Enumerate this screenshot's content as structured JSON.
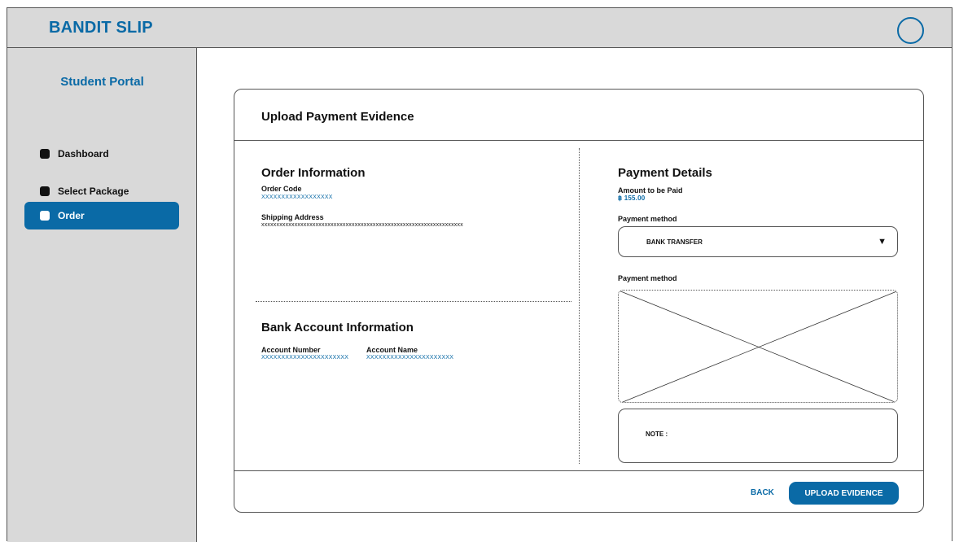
{
  "app": {
    "brand": "BANDIT SLIP"
  },
  "sidebar": {
    "title": "Student Portal",
    "items": [
      {
        "label": "Dashboard",
        "active": false
      },
      {
        "label": "Select Package",
        "active": false
      },
      {
        "label": "Order",
        "active": true
      }
    ]
  },
  "card": {
    "title": "Upload Payment Evidence",
    "order_info": {
      "title": "Order Information",
      "order_code_label": "Order Code",
      "order_code_value": "XXXXXXXXXXXXXXXXXX",
      "shipping_label": "Shipping Address",
      "shipping_value": "xxxxxxxxxxxxxxxxxxxxxxxxxxxxxxxxxxxxxxxxxxxxxxxxxxxxxxxxxxxxxxxxxxx"
    },
    "bank_info": {
      "title": "Bank Account Information",
      "account_number_label": "Account Number",
      "account_number_value": "XXXXXXXXXXXXXXXXXXXXXX",
      "account_name_label": "Account Name",
      "account_name_value": "XXXXXXXXXXXXXXXXXXXXXX"
    },
    "payment": {
      "title": "Payment Details",
      "amount_label": "Amount to be Paid",
      "amount_value": "฿ 155.00",
      "method_label": "Payment method",
      "method_value": "BANK TRANSFER",
      "evidence_label": "Payment method",
      "note_label": "NOTE :"
    },
    "actions": {
      "back": "BACK",
      "upload": "UPLOAD EVIDENCE"
    }
  },
  "colors": {
    "accent": "#0a6aa6",
    "panel": "#d9d9d9"
  },
  "icons": {
    "profile": "circle-icon",
    "dropdown": "triangle-down-icon",
    "nav_bullet": "square-icon"
  }
}
